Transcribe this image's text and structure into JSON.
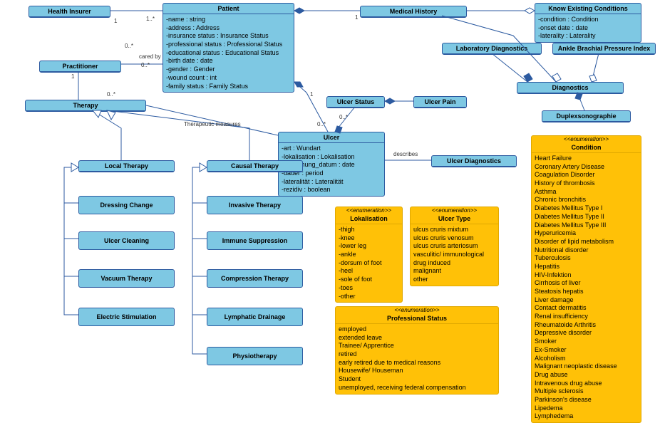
{
  "classes": {
    "healthInsurer": {
      "title": "Health Insurer"
    },
    "patient": {
      "title": "Patient",
      "attrs": [
        "-name : string",
        "-address : Address",
        "-insurance status : Insurance Status",
        "-professional status : Professional Status",
        "-educational status : Educational Status",
        "-birth date : date",
        "-gender : Gender",
        "-wound count : int",
        "-family status : Family Status"
      ]
    },
    "medicalHistory": {
      "title": "Medical History"
    },
    "knownConditions": {
      "title": "Know Existing Conditions",
      "attrs": [
        "-condition : Condition",
        "-onset date : date",
        "-laterality : Laterality"
      ]
    },
    "practitioner": {
      "title": "Practitioner"
    },
    "therapy": {
      "title": "Therapy"
    },
    "ulcerStatus": {
      "title": "Ulcer Status"
    },
    "ulcerPain": {
      "title": "Ulcer Pain"
    },
    "ulcer": {
      "title": "Ulcer",
      "attrs": [
        "-art : Wundart",
        "-lokalisation : Lokalisation",
        "-entstehung_datum : date",
        "-dauer : period",
        "-lateralität : Lateralität",
        "-rezidiv : boolean"
      ]
    },
    "laboratoryDiagnostics": {
      "title": "Laboratory Diagnostics"
    },
    "ankleBrachial": {
      "title": "Ankle Brachial Pressure Index"
    },
    "diagnostics": {
      "title": "Diagnostics"
    },
    "duplexsono": {
      "title": "Duplexsonographie"
    },
    "ulcerDiagnostics": {
      "title": "Ulcer Diagnostics"
    },
    "localTherapy": {
      "title": "Local Therapy"
    },
    "causalTherapy": {
      "title": "Causal Therapy"
    },
    "dressingChange": {
      "title": "Dressing Change"
    },
    "ulcerCleaning": {
      "title": "Ulcer Cleaning"
    },
    "vacuumTherapy": {
      "title": "Vacuum Therapy"
    },
    "electricStimulation": {
      "title": "Electric Stimulation"
    },
    "invasiveTherapy": {
      "title": "Invasive Therapy"
    },
    "immuneSuppression": {
      "title": "Immune Suppression"
    },
    "compressionTherapy": {
      "title": "Compression Therapy"
    },
    "lymphaticDrainage": {
      "title": "Lymphatic Drainage"
    },
    "physiotherapy": {
      "title": "Physiotherapy"
    }
  },
  "enums": {
    "lokalisation": {
      "stereo": "<<enumeration>>",
      "title": "Lokalisation",
      "attrs": [
        "-thigh",
        "-knee",
        "-lower leg",
        "-ankle",
        "-dorsum of foot",
        "-heel",
        "-sole of foot",
        "-toes",
        "-other"
      ]
    },
    "ulcerType": {
      "stereo": "<<enumeration>>",
      "title": "Ulcer Type",
      "attrs": [
        "ulcus cruris mixtum",
        "ulcus cruris venosum",
        "ulcus cruris arteriosum",
        "vasculitic/ immunological",
        "drug induced",
        "malignant",
        "other"
      ]
    },
    "professionalStatus": {
      "stereo": "<<enumeration>>",
      "title": "Professional Status",
      "attrs": [
        "employed",
        "extended leave",
        "Trainee/ Apprentice",
        "retired",
        "early retired due to medical reasons",
        "Housewife/ Houseman",
        "Student",
        "unemployed, receiving federal compensation"
      ]
    },
    "condition": {
      "stereo": "<<enumeration>>",
      "title": "Condition",
      "attrs": [
        "Heart Failure",
        "Coronary Artery Disease",
        "Coagulation Disorder",
        "History of thrombosis",
        "Asthma",
        "Chronic bronchitis",
        "Diabetes Mellitus Type I",
        "Diabetes Mellitus Type II",
        "Diabetes Mellitus Type III",
        "Hyperuricemia",
        "Disorder of lipid metabolism",
        "Nutritional disorder",
        "Tuberculosis",
        "Hepatitis",
        "HIV-Infektion",
        "Cirrhosis of liver",
        "Steatosis hepatis",
        "Liver damage",
        "Contact dermatitis",
        "Renal insufficiency",
        "Rheumatoide Arthritis",
        "Depressive disorder",
        "Smoker",
        "Ex-Smoker",
        "Alcoholism",
        "Malignant neoplastic disease",
        "Drug abuse",
        "Intravenous drug abuse",
        "Multiple sclerosis",
        "Parkinson's disease",
        "Lipedema",
        "Lymphedema"
      ]
    }
  },
  "labels": {
    "caredBy": "cared by",
    "therapeuticMeasures": "Therapeutic measures",
    "describes": "describes",
    "one": "1",
    "onedots": "1..*",
    "zerodots": "0..*"
  },
  "chart_data": {
    "type": "uml-class-diagram",
    "classes": [
      "Health Insurer",
      "Patient",
      "Medical History",
      "Know Existing Conditions",
      "Practitioner",
      "Therapy",
      "Ulcer Status",
      "Ulcer Pain",
      "Ulcer",
      "Laboratory Diagnostics",
      "Ankle Brachial Pressure Index",
      "Diagnostics",
      "Duplexsonographie",
      "Ulcer Diagnostics",
      "Local Therapy",
      "Causal Therapy",
      "Dressing Change",
      "Ulcer Cleaning",
      "Vacuum Therapy",
      "Electric Stimulation",
      "Invasive Therapy",
      "Immune Suppression",
      "Compression Therapy",
      "Lymphatic Drainage",
      "Physiotherapy"
    ],
    "enumerations": [
      "Lokalisation",
      "Ulcer Type",
      "Professional Status",
      "Condition"
    ],
    "relationships": [
      {
        "from": "Health Insurer",
        "to": "Patient",
        "type": "association",
        "fromMult": "1",
        "toMult": "1..*"
      },
      {
        "from": "Practitioner",
        "to": "Patient",
        "type": "association",
        "label": "cared by",
        "fromMult": "0..*",
        "toMult": "0..*"
      },
      {
        "from": "Practitioner",
        "to": "Therapy",
        "type": "association",
        "fromMult": "1",
        "toMult": "0..*"
      },
      {
        "from": "Therapy",
        "to": "Ulcer",
        "type": "association",
        "label": "Therapeutic measures",
        "fromMult": "0..*",
        "toMult": "1"
      },
      {
        "from": "Patient",
        "to": "Medical History",
        "type": "composition",
        "toMult": "1"
      },
      {
        "from": "Medical History",
        "to": "Know Existing Conditions",
        "type": "aggregation"
      },
      {
        "from": "Medical History",
        "to": "Diagnostics",
        "type": "aggregation"
      },
      {
        "from": "Patient",
        "to": "Ulcer",
        "type": "composition",
        "toMult": "0..*"
      },
      {
        "from": "Ulcer",
        "to": "Ulcer Status",
        "type": "composition",
        "toMult": "0..*"
      },
      {
        "from": "Ulcer Status",
        "to": "Ulcer Pain",
        "type": "composition"
      },
      {
        "from": "Ulcer",
        "to": "Ulcer Diagnostics",
        "type": "association",
        "label": "describes"
      },
      {
        "from": "Diagnostics",
        "to": "Laboratory Diagnostics",
        "type": "composition"
      },
      {
        "from": "Diagnostics",
        "to": "Ankle Brachial Pressure Index",
        "type": "aggregation"
      },
      {
        "from": "Diagnostics",
        "to": "Duplexsonographie",
        "type": "composition"
      },
      {
        "from": "Local Therapy",
        "to": "Therapy",
        "type": "generalization"
      },
      {
        "from": "Causal Therapy",
        "to": "Therapy",
        "type": "generalization"
      },
      {
        "from": "Dressing Change",
        "to": "Local Therapy",
        "type": "generalization"
      },
      {
        "from": "Ulcer Cleaning",
        "to": "Local Therapy",
        "type": "generalization"
      },
      {
        "from": "Vacuum Therapy",
        "to": "Local Therapy",
        "type": "generalization"
      },
      {
        "from": "Electric Stimulation",
        "to": "Local Therapy",
        "type": "generalization"
      },
      {
        "from": "Invasive Therapy",
        "to": "Causal Therapy",
        "type": "generalization"
      },
      {
        "from": "Immune Suppression",
        "to": "Causal Therapy",
        "type": "generalization"
      },
      {
        "from": "Compression Therapy",
        "to": "Causal Therapy",
        "type": "generalization"
      },
      {
        "from": "Lymphatic Drainage",
        "to": "Causal Therapy",
        "type": "generalization"
      },
      {
        "from": "Physiotherapy",
        "to": "Causal Therapy",
        "type": "generalization"
      }
    ]
  }
}
